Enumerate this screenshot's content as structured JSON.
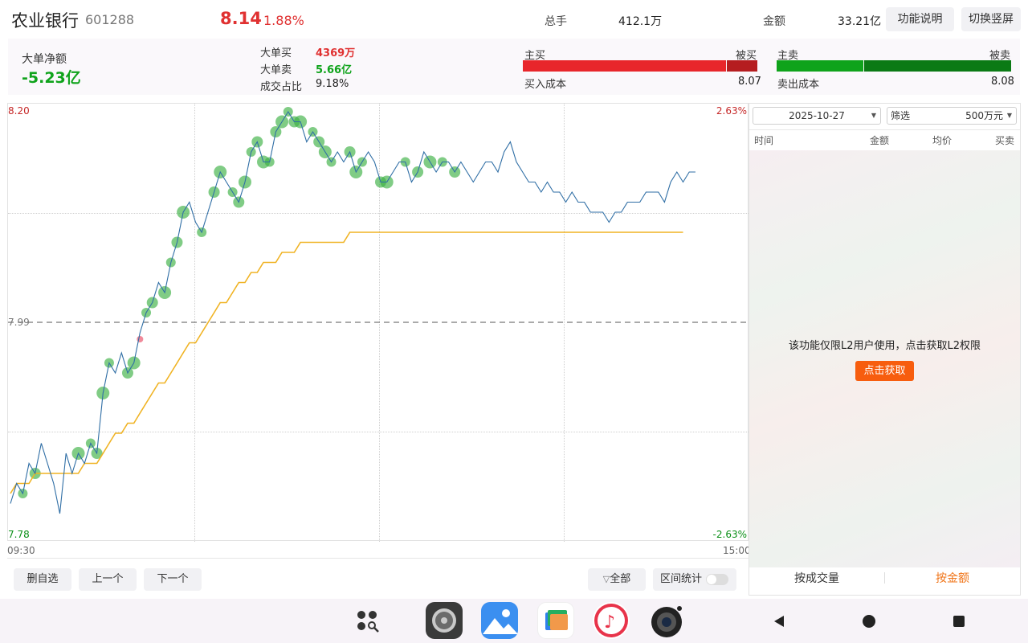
{
  "header": {
    "stock_name": "农业银行",
    "stock_code": "601288",
    "price": "8.14",
    "change_pct": "1.88%",
    "volume_label": "总手",
    "volume_value": "412.1万",
    "amount_label": "金额",
    "amount_value": "33.21亿",
    "feature_btn": "功能说明",
    "switch_btn": "切换竖屏"
  },
  "summary": {
    "net_label": "大单净额",
    "net_value": "-5.23亿",
    "big_buy_label": "大单买",
    "big_buy_value": "4369万",
    "big_sell_label": "大单卖",
    "big_sell_value": "5.66亿",
    "ratio_label": "成交占比",
    "ratio_value": "9.18%",
    "active_buy_label": "主买",
    "passive_buy_label": "被买",
    "buy_cost_label": "买入成本",
    "buy_cost_value": "8.07",
    "active_sell_label": "主卖",
    "passive_sell_label": "被卖",
    "sell_cost_label": "卖出成本",
    "sell_cost_value": "8.08",
    "colors": {
      "red": "#e8262b",
      "dark_red": "#b51d20",
      "green": "#0fa31b",
      "dark_green": "#0b7a15"
    }
  },
  "chart_data": {
    "type": "line",
    "y_left_top": "8.20",
    "y_left_mid": "7.99",
    "y_left_bottom": "7.78",
    "y_right_top": "2.63%",
    "y_right_bottom": "-2.63%",
    "x_start": "09:30",
    "x_end": "15:00",
    "ylim": [
      7.78,
      8.2
    ],
    "prev_close": 7.99,
    "x_total_minutes": 240,
    "price_series": [
      7.81,
      7.83,
      7.82,
      7.85,
      7.84,
      7.87,
      7.85,
      7.83,
      7.8,
      7.86,
      7.84,
      7.86,
      7.85,
      7.87,
      7.86,
      7.92,
      7.95,
      7.94,
      7.96,
      7.94,
      7.95,
      7.98,
      8.0,
      8.01,
      8.03,
      8.02,
      8.05,
      8.07,
      8.1,
      8.11,
      8.09,
      8.08,
      8.1,
      8.12,
      8.14,
      8.13,
      8.12,
      8.11,
      8.13,
      8.16,
      8.17,
      8.15,
      8.15,
      8.18,
      8.19,
      8.2,
      8.19,
      8.19,
      8.17,
      8.18,
      8.17,
      8.16,
      8.15,
      8.16,
      8.15,
      8.16,
      8.14,
      8.15,
      8.16,
      8.15,
      8.13,
      8.13,
      8.14,
      8.15,
      8.15,
      8.13,
      8.14,
      8.16,
      8.15,
      8.14,
      8.15,
      8.15,
      8.14,
      8.15,
      8.14,
      8.13,
      8.14,
      8.15,
      8.15,
      8.14,
      8.16,
      8.17,
      8.15,
      8.14,
      8.13,
      8.13,
      8.12,
      8.13,
      8.12,
      8.12,
      8.11,
      8.12,
      8.11,
      8.11,
      8.1,
      8.1,
      8.1,
      8.09,
      8.1,
      8.1,
      8.11,
      8.11,
      8.11,
      8.12,
      8.12,
      8.12,
      8.11,
      8.13,
      8.14,
      8.13,
      8.14,
      8.14
    ],
    "avg_series": [
      7.82,
      7.83,
      7.83,
      7.83,
      7.84,
      7.84,
      7.84,
      7.84,
      7.84,
      7.84,
      7.84,
      7.84,
      7.85,
      7.85,
      7.85,
      7.86,
      7.87,
      7.88,
      7.88,
      7.89,
      7.89,
      7.9,
      7.91,
      7.92,
      7.93,
      7.93,
      7.94,
      7.95,
      7.96,
      7.97,
      7.97,
      7.98,
      7.99,
      8.0,
      8.01,
      8.01,
      8.02,
      8.03,
      8.03,
      8.04,
      8.04,
      8.05,
      8.05,
      8.05,
      8.06,
      8.06,
      8.06,
      8.07,
      8.07,
      8.07,
      8.07,
      8.07,
      8.07,
      8.07,
      8.07,
      8.08,
      8.08,
      8.08,
      8.08,
      8.08,
      8.08,
      8.08,
      8.08,
      8.08,
      8.08,
      8.08,
      8.08,
      8.08,
      8.08,
      8.08,
      8.08,
      8.08,
      8.08,
      8.08,
      8.08,
      8.08,
      8.08,
      8.08,
      8.08,
      8.08,
      8.08,
      8.08,
      8.08,
      8.08,
      8.08,
      8.08,
      8.08,
      8.08,
      8.08,
      8.08,
      8.08,
      8.08,
      8.08,
      8.08,
      8.08,
      8.08,
      8.08,
      8.08,
      8.08,
      8.08,
      8.08,
      8.08,
      8.08,
      8.08,
      8.08,
      8.08,
      8.08,
      8.08,
      8.08,
      8.08
    ],
    "big_sell_marker_indices": [
      2,
      4,
      11,
      13,
      14,
      15,
      16,
      19,
      20,
      22,
      23,
      25,
      26,
      27,
      28,
      31,
      33,
      34,
      36,
      37,
      38,
      39,
      40,
      41,
      42,
      43,
      44,
      45,
      46,
      47,
      49,
      50,
      51,
      52,
      55,
      56,
      57,
      60,
      61,
      64,
      66,
      68,
      70,
      72
    ],
    "big_buy_marker_indices": [
      21
    ],
    "colors": {
      "price_line": "#2f6ea5",
      "avg_line": "#f0b323",
      "sell_marker": "#3cb043",
      "buy_marker": "#f08a9a"
    }
  },
  "right_panel": {
    "date": "2025-10-27",
    "filter_label": "筛选",
    "filter_value": "500万元",
    "col_time": "时间",
    "col_amount": "金额",
    "col_avg": "均价",
    "col_side": "买卖",
    "locked_msg": "该功能仅限L2用户使用，点击获取L2权限",
    "get_btn": "点击获取",
    "tab_volume": "按成交量",
    "tab_amount": "按金额"
  },
  "bottom": {
    "remove_btn": "删自选",
    "prev_btn": "上一个",
    "next_btn": "下一个",
    "all_btn": "全部",
    "range_label": "区间统计"
  }
}
